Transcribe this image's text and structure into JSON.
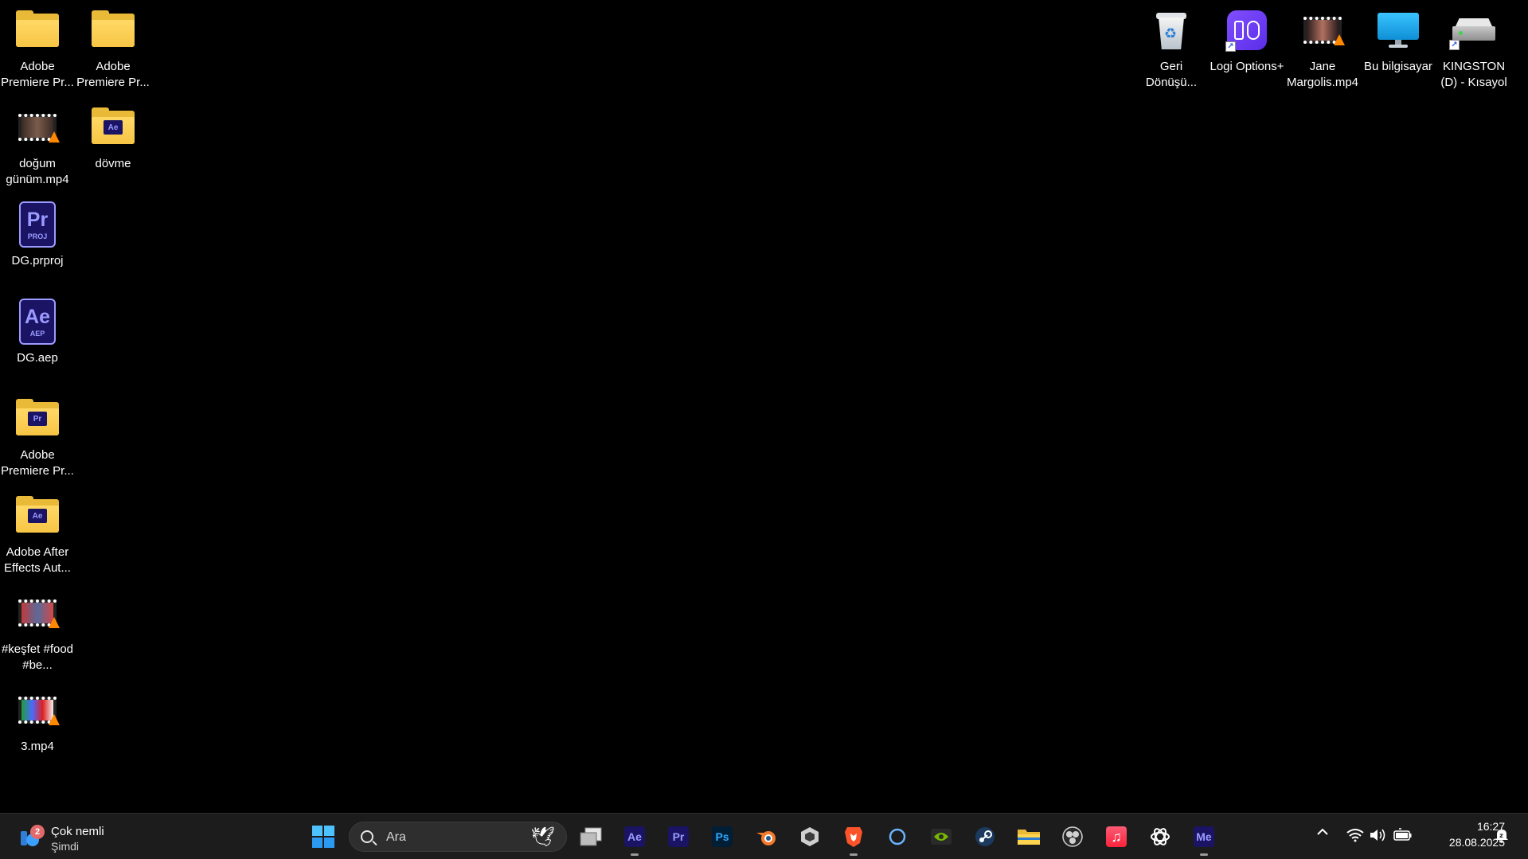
{
  "desktop": {
    "left_column": [
      {
        "label": "Adobe Premiere Pr...",
        "icon": "folder-icon"
      },
      {
        "label": "Adobe Premiere Pr...",
        "icon": "folder-icon"
      },
      {
        "label": "doğum günüm.mp4",
        "icon": "video-file-icon"
      },
      {
        "label": "dövme",
        "icon": "after-effects-folder-icon",
        "badge": "Ae"
      },
      {
        "label": "DG.prproj",
        "icon": "premiere-project-icon",
        "big": "Pr",
        "small": "PROJ"
      },
      {
        "label": "DG.aep",
        "icon": "after-effects-project-icon",
        "big": "Ae",
        "small": "AEP"
      },
      {
        "label": "Adobe Premiere Pr...",
        "icon": "premiere-folder-icon",
        "badge": "Pr"
      },
      {
        "label": "Adobe After Effects Aut...",
        "icon": "after-effects-folder-icon",
        "badge": "Ae"
      },
      {
        "label": "#keşfet #food #be...",
        "icon": "video-file-icon"
      },
      {
        "label": "3.mp4",
        "icon": "video-file-icon"
      }
    ],
    "right_row": [
      {
        "label": "Geri Dönüşü...",
        "icon": "recycle-bin-icon"
      },
      {
        "label": "Logi Options+",
        "icon": "logi-options-icon"
      },
      {
        "label": "Jane Margolis.mp4",
        "icon": "video-file-icon"
      },
      {
        "label": "Bu bilgisayar",
        "icon": "computer-icon"
      },
      {
        "label": "KINGSTON (D) - Kısayol",
        "icon": "drive-shortcut-icon"
      }
    ]
  },
  "taskbar": {
    "weather": {
      "line1": "Çok nemli",
      "line2": "Şimdi",
      "notification_count": "2"
    },
    "search": {
      "placeholder": "Ara"
    },
    "apps": [
      {
        "name": "start-button",
        "icon": "windows-icon"
      },
      {
        "name": "task-view",
        "icon": "task-view-icon"
      },
      {
        "name": "after-effects",
        "icon": "after-effects-icon",
        "text": "Ae",
        "running": true
      },
      {
        "name": "premiere-pro",
        "icon": "premiere-pro-icon",
        "text": "Pr"
      },
      {
        "name": "photoshop",
        "icon": "photoshop-icon",
        "text": "Ps"
      },
      {
        "name": "blender",
        "icon": "blender-icon"
      },
      {
        "name": "unity",
        "icon": "unity-icon"
      },
      {
        "name": "brave",
        "icon": "brave-icon",
        "running": true
      },
      {
        "name": "cortana",
        "icon": "circle-icon"
      },
      {
        "name": "nvidia",
        "icon": "nvidia-icon"
      },
      {
        "name": "steam",
        "icon": "steam-icon"
      },
      {
        "name": "file-explorer",
        "icon": "folder-icon"
      },
      {
        "name": "obs",
        "icon": "obs-icon"
      },
      {
        "name": "apple-music",
        "icon": "music-icon"
      },
      {
        "name": "chatgpt",
        "icon": "chatgpt-icon"
      },
      {
        "name": "media-encoder",
        "icon": "media-encoder-icon",
        "text": "Me",
        "running": true
      }
    ],
    "clock": {
      "time": "16:27",
      "date": "28.08.2025"
    }
  },
  "colors": {
    "adobe_purple": "#9b9bff",
    "adobe_bg": "#1b1464",
    "photoshop_blue": "#31a8ff",
    "folder_yellow": "#f7c545",
    "taskbar_bg": "#1c1c1c"
  }
}
